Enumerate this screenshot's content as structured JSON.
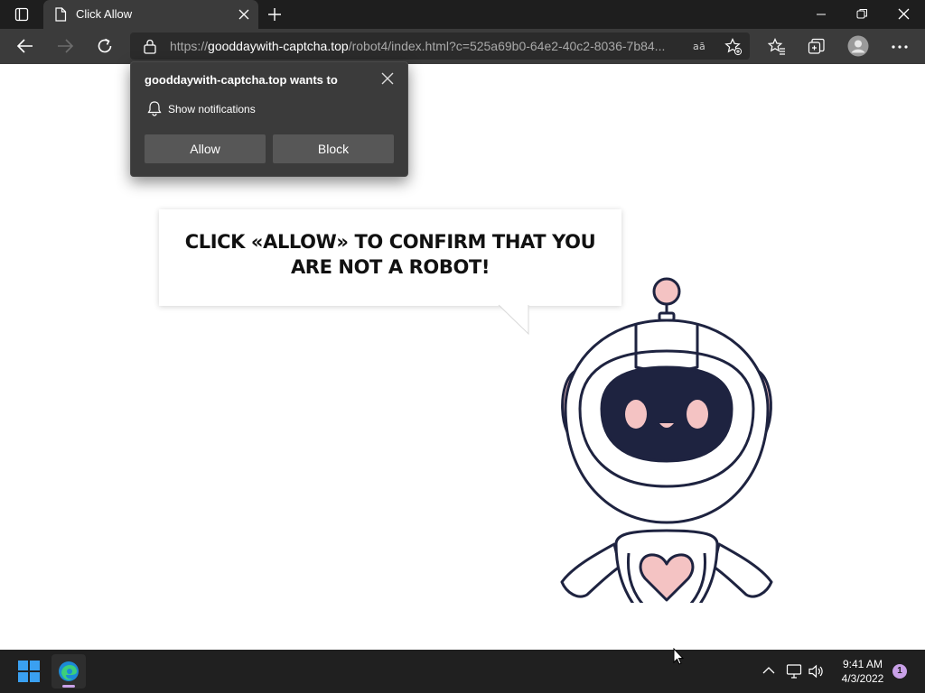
{
  "browser": {
    "tab_title": "Click Allow",
    "url_scheme": "https://",
    "url_host": "gooddaywith-captcha.top",
    "url_rest": "/robot4/index.html?c=525a69b0-64e2-40c2-8036-7b84..."
  },
  "permission_popup": {
    "title": "gooddaywith-captcha.top wants to",
    "permission": "Show notifications",
    "allow_label": "Allow",
    "block_label": "Block"
  },
  "page": {
    "message_line1": "CLICK «ALLOW» TO CONFIRM THAT YOU",
    "message_line2": "ARE NOT A ROBOT!"
  },
  "taskbar": {
    "time": "9:41 AM",
    "date": "4/3/2022",
    "notification_count": "1"
  },
  "colors": {
    "robot_outline": "#1e2340",
    "robot_pink": "#f4c3c3",
    "browser_dark": "#3b3b3b",
    "taskbar": "#202020"
  }
}
